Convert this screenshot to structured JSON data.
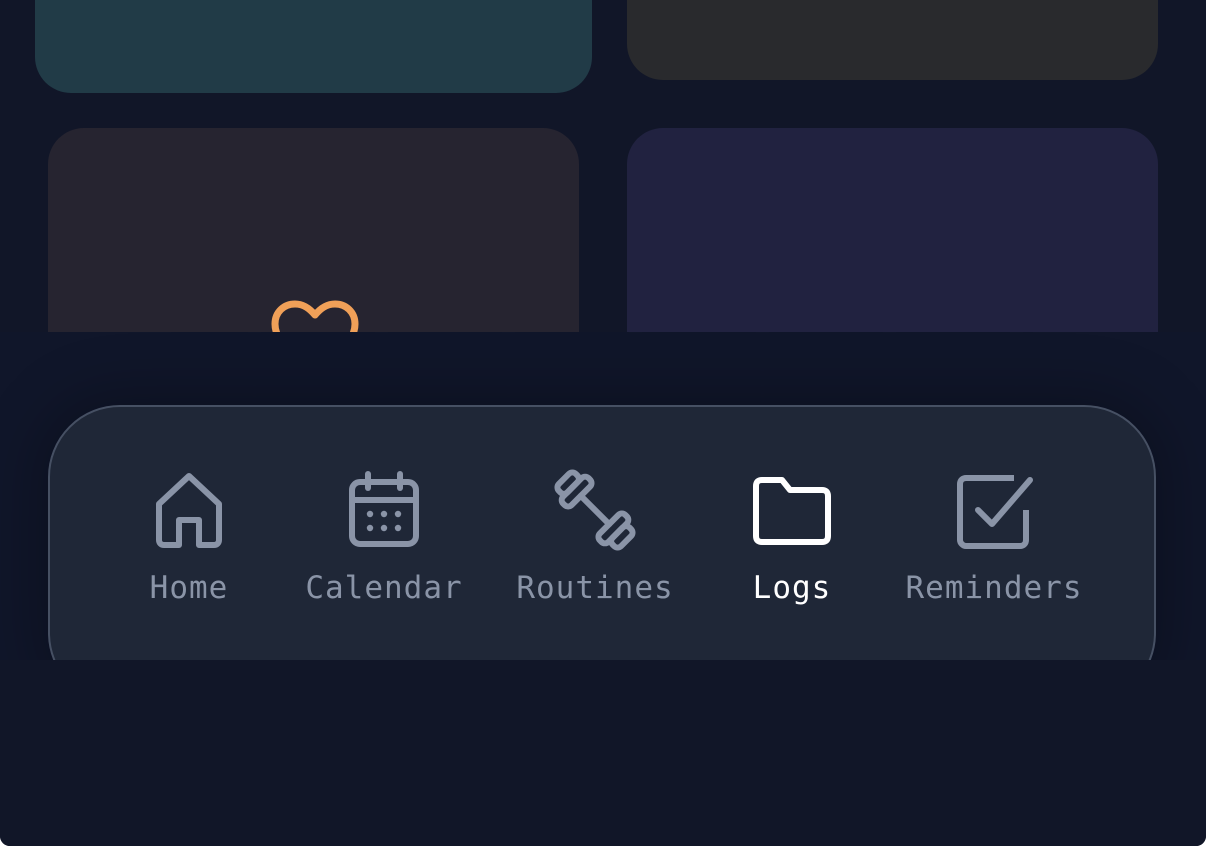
{
  "colors": {
    "background": "#111628",
    "nav_background": "#1f2737",
    "nav_border": "#465063",
    "inactive": "#8a94a7",
    "active": "#ffffff",
    "fitness_accent": "#f0a058",
    "journal_accent": "#b785f5"
  },
  "cards": [
    {
      "name": "teal-card",
      "color": "#213b47"
    },
    {
      "name": "gray-card",
      "color": "#292a2d"
    },
    {
      "name": "fitness-card",
      "color": "#262430",
      "icon": "heart-icon"
    },
    {
      "name": "journal-card",
      "color": "#212240",
      "icon": "book-icon"
    }
  ],
  "nav": {
    "items": [
      {
        "label": "Home",
        "icon": "home-icon",
        "active": false
      },
      {
        "label": "Calendar",
        "icon": "calendar-icon",
        "active": false
      },
      {
        "label": "Routines",
        "icon": "dumbbell-icon",
        "active": false
      },
      {
        "label": "Logs",
        "icon": "folder-icon",
        "active": true
      },
      {
        "label": "Reminders",
        "icon": "checkbox-icon",
        "active": false
      }
    ]
  }
}
